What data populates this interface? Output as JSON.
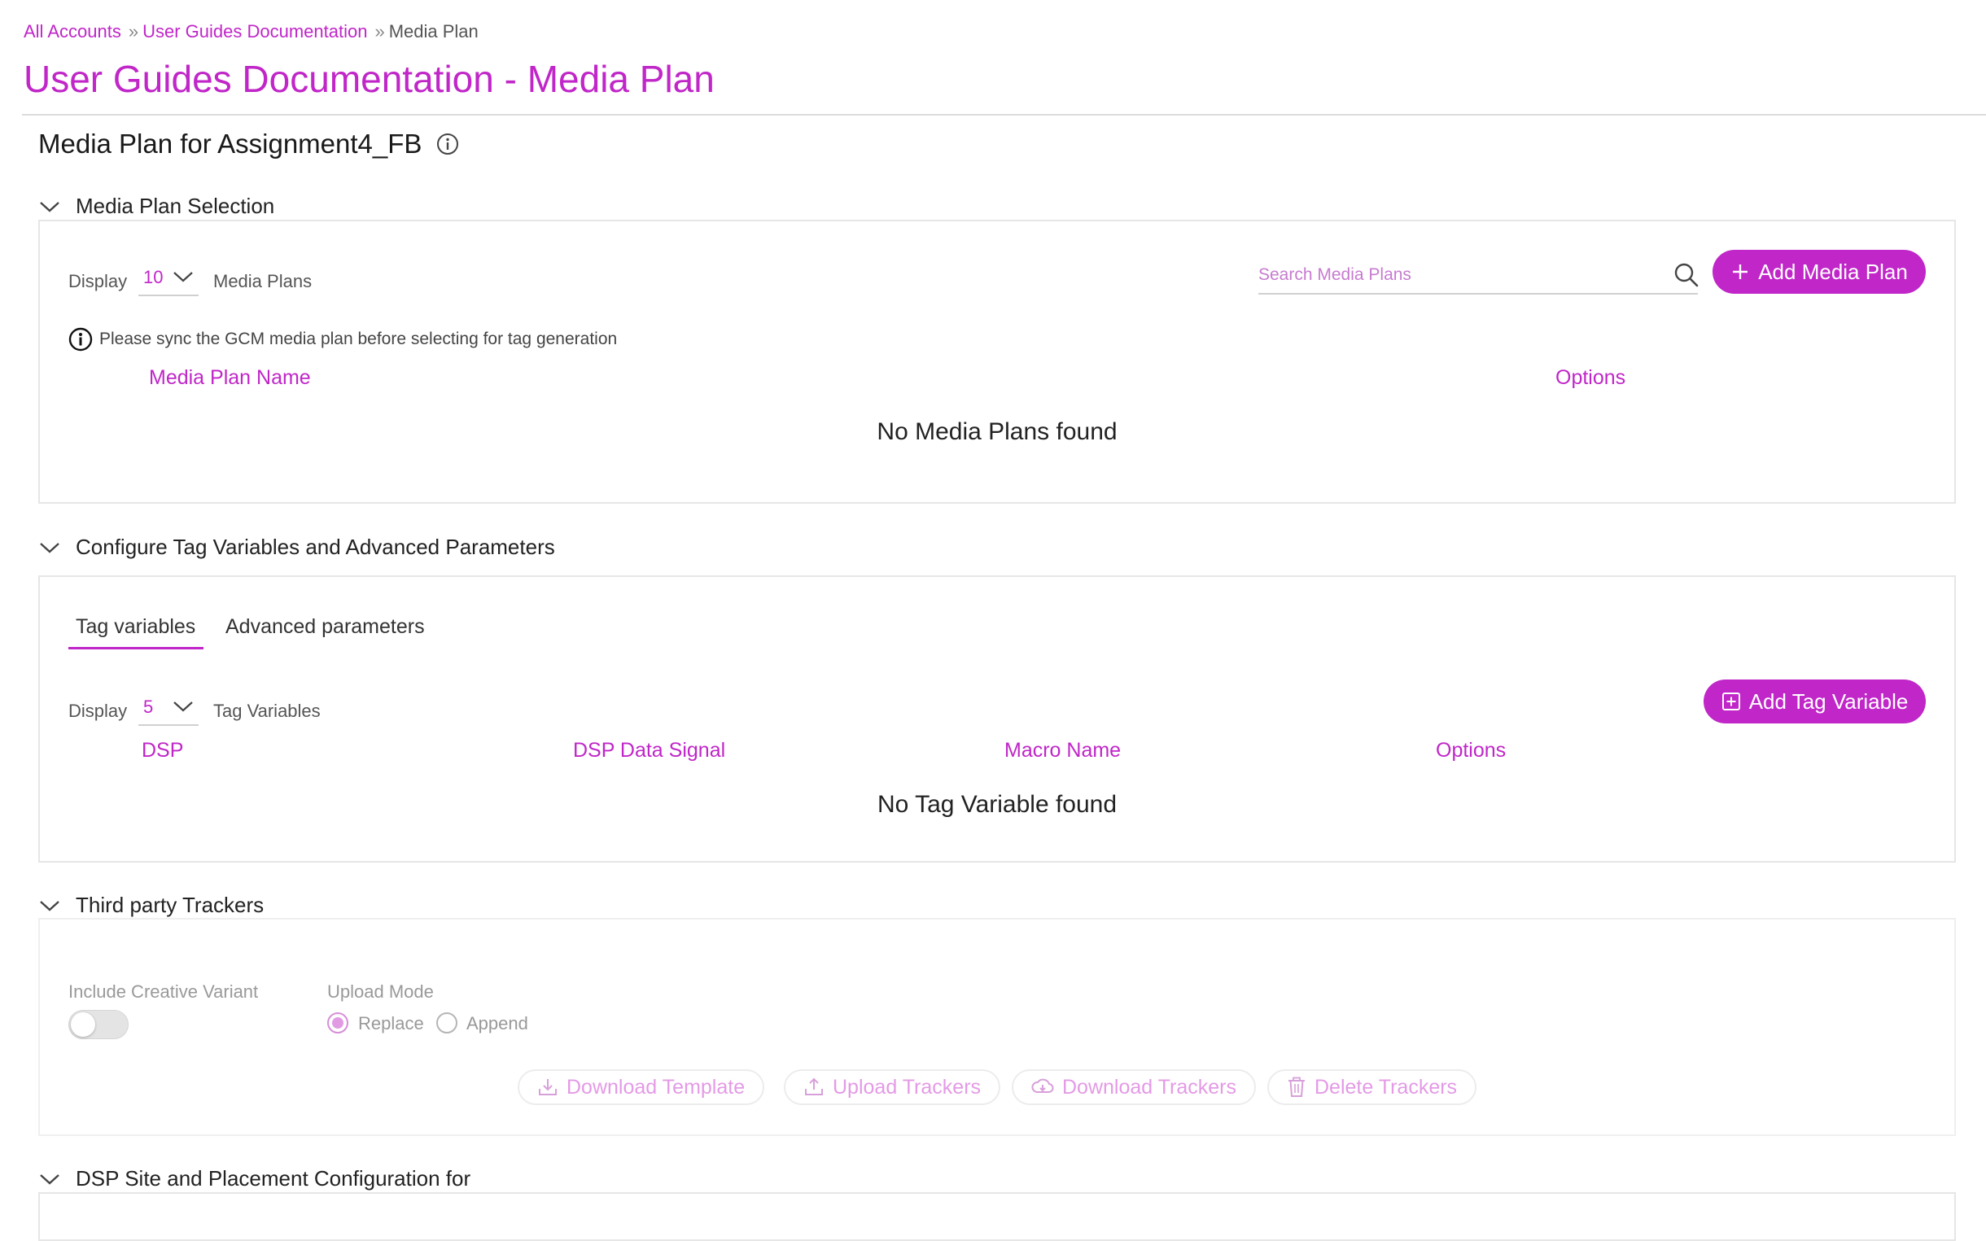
{
  "breadcrumb": {
    "items": [
      "All Accounts",
      "User Guides Documentation",
      "Media Plan"
    ],
    "separator": "»"
  },
  "page": {
    "title": "User Guides Documentation - Media Plan",
    "media_plan_heading": "Media Plan for Assignment4_FB"
  },
  "sections": {
    "media_plan_selection": {
      "title": "Media Plan Selection",
      "display_label": "Display",
      "display_value": "10",
      "display_suffix": "Media Plans",
      "search_placeholder": "Search Media Plans",
      "add_button": "Add Media Plan",
      "notice": "Please sync the GCM media plan before selecting for tag generation",
      "columns": [
        "Media Plan Name",
        "Options"
      ],
      "empty_message": "No Media Plans found"
    },
    "tag_variables": {
      "title": "Configure Tag Variables and Advanced Parameters",
      "tabs": [
        "Tag variables",
        "Advanced parameters"
      ],
      "active_tab": "Tag variables",
      "display_label": "Display",
      "display_value": "5",
      "display_suffix": "Tag Variables",
      "add_button": "Add Tag Variable",
      "columns": [
        "DSP",
        "DSP Data Signal",
        "Macro Name",
        "Options"
      ],
      "empty_message": "No Tag Variable found"
    },
    "third_party_trackers": {
      "title": "Third party Trackers",
      "include_creative_variant_label": "Include Creative Variant",
      "include_creative_variant_on": false,
      "upload_mode_label": "Upload Mode",
      "upload_modes": [
        "Replace",
        "Append"
      ],
      "selected_upload_mode": "Replace",
      "buttons": [
        "Download Template",
        "Upload Trackers",
        "Download Trackers",
        "Delete Trackers"
      ]
    },
    "dsp_site_placement": {
      "title": "DSP Site and Placement Configuration for"
    }
  },
  "colors": {
    "accent": "#c026c8",
    "muted_accent": "#e49ae6",
    "border": "#e6e6e6"
  }
}
